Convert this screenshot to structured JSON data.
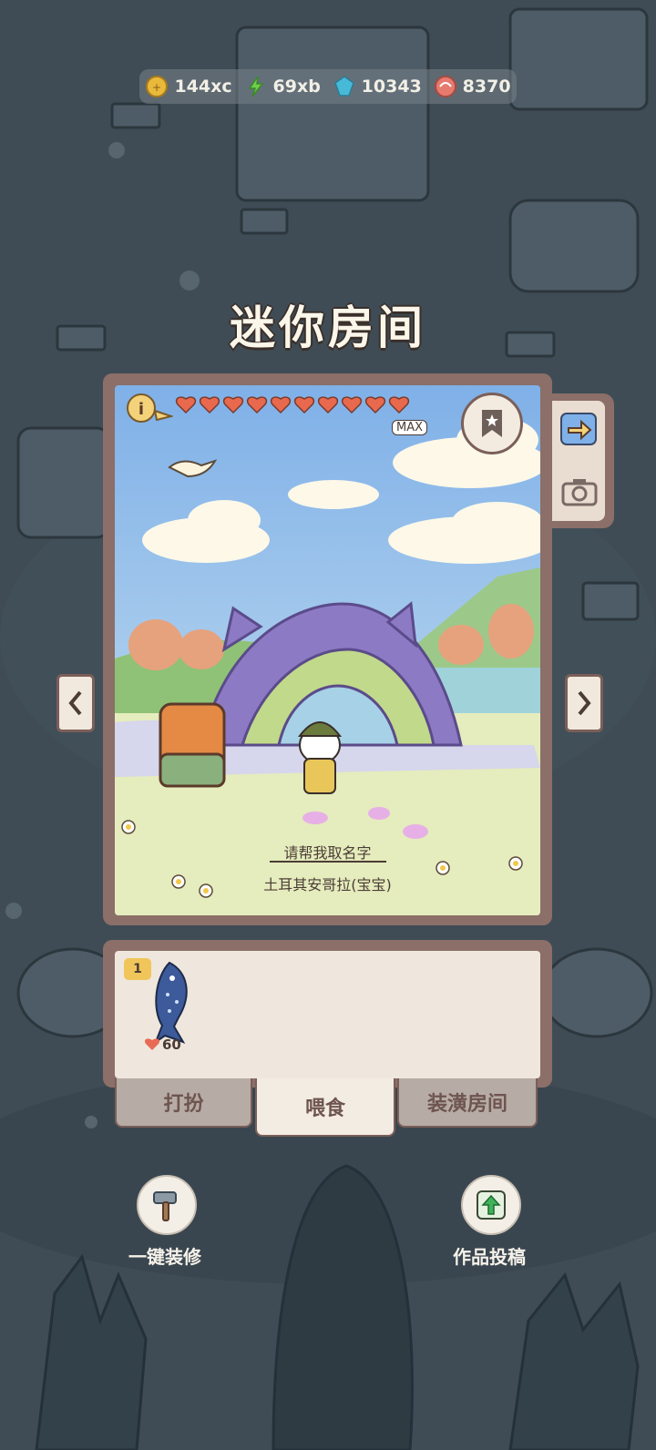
{
  "currencies": [
    {
      "icon": "coin-icon",
      "value": "144xc",
      "color": "#e8b93b"
    },
    {
      "icon": "lightning-icon",
      "value": "69xb",
      "color": "#6fcf4a"
    },
    {
      "icon": "gem-icon",
      "value": "10343",
      "color": "#49b9d8"
    },
    {
      "icon": "shell-icon",
      "value": "8370",
      "color": "#e77a6e"
    }
  ],
  "title": "迷你房间",
  "room": {
    "max_label": "MAX",
    "hearts_filled": 10,
    "hearts_total": 10,
    "name_prompt": "请帮我取名字",
    "pet_name": "土耳其安哥拉(宝宝)"
  },
  "feed": {
    "item_count": "1",
    "item_value": "60"
  },
  "tabs": [
    {
      "label": "打扮"
    },
    {
      "label": "喂食"
    },
    {
      "label": "装潢房间"
    }
  ],
  "actions": {
    "renovate_label": "一键装修",
    "submit_label": "作品投稿"
  }
}
